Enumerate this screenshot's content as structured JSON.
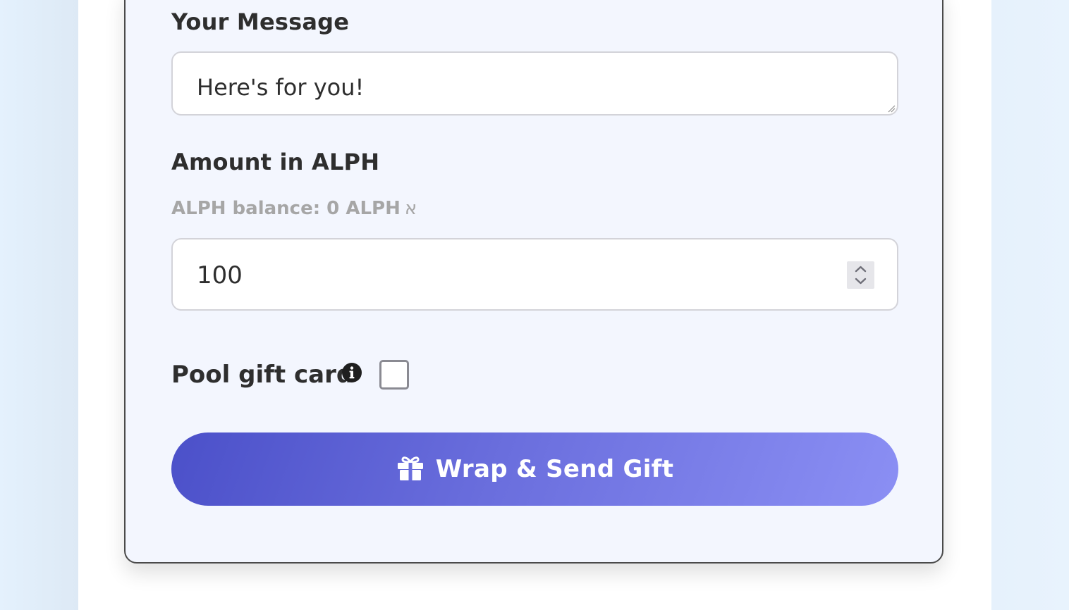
{
  "form": {
    "message_label": "Your Message",
    "message_value": "Here's for you!",
    "amount_label": "Amount in ALPH",
    "balance_text": "ALPH balance: 0 ALPH",
    "balance_symbol": "א",
    "amount_value": "100",
    "pool_label": "Pool gift card",
    "pool_checked": false,
    "submit_label": "Wrap & Send Gift"
  },
  "icons": {
    "info": "info-icon",
    "gift": "gift-icon",
    "spinner": "number-stepper-icon",
    "resize": "resize-grip-icon"
  },
  "colors": {
    "card_background": "#f3f6fe",
    "button_gradient_start": "#4b50c9",
    "button_gradient_end": "#8b8ff4",
    "label_text": "#2e2e2e",
    "muted_text": "#a6a6a6"
  }
}
